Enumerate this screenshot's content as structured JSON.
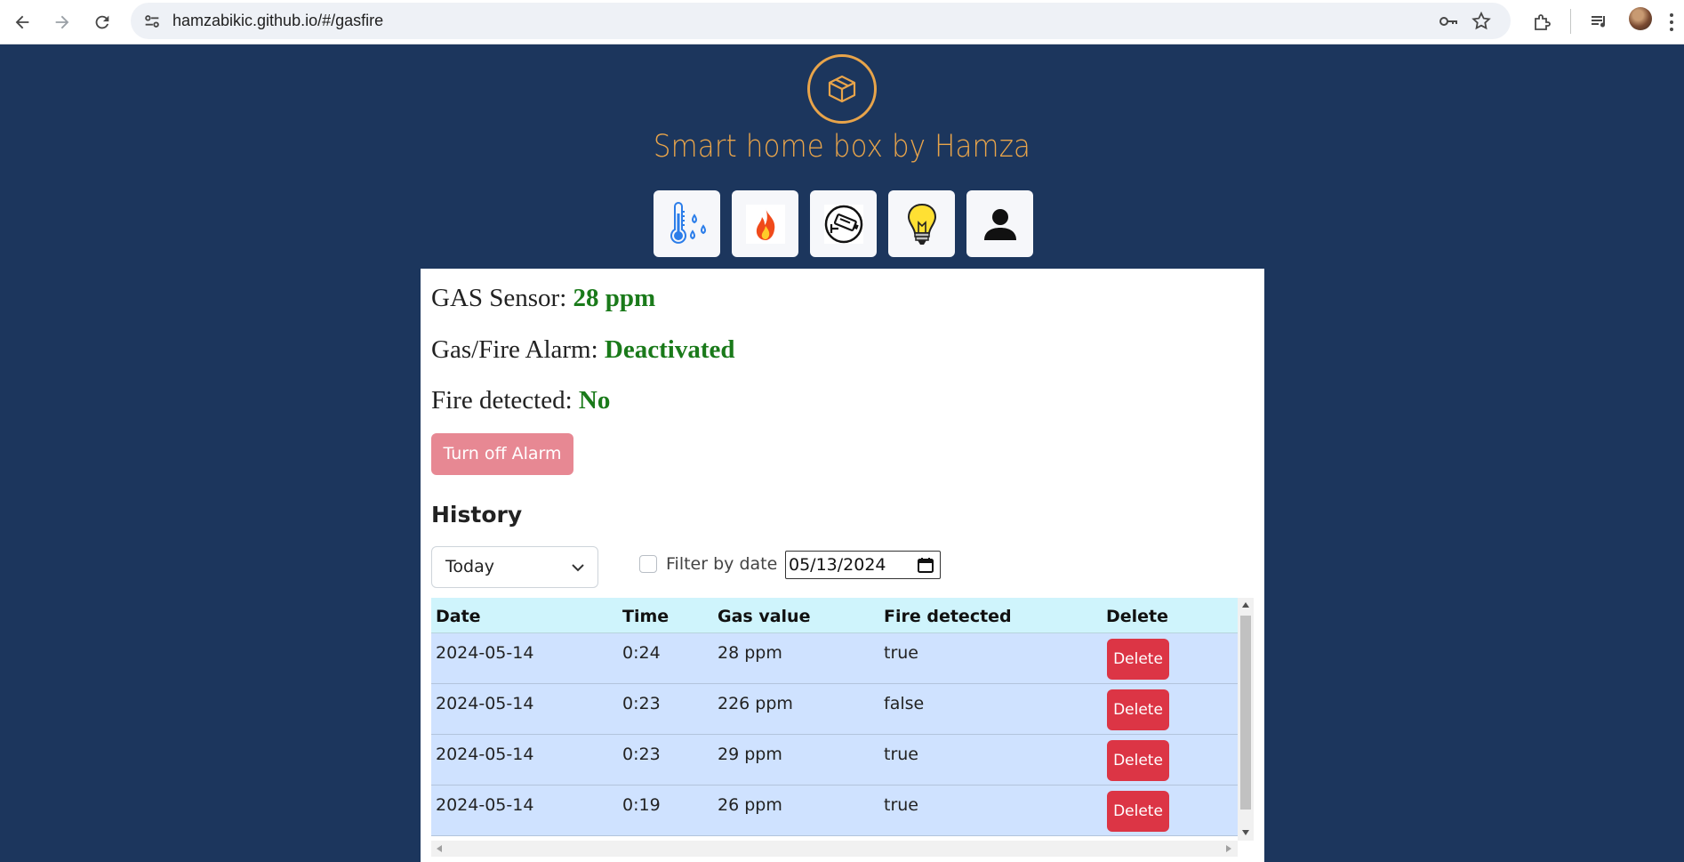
{
  "browser": {
    "url": "hamzabikic.github.io/#/gasfire"
  },
  "app": {
    "title": "Smart home box by Hamza",
    "colors": {
      "background": "#1c365d",
      "accent": "#e8a44a",
      "ok": "#1a7a1a",
      "danger": "#dc3545"
    },
    "nav_tiles": [
      {
        "name": "temperature-humidity",
        "icon": "thermometer-drops-icon"
      },
      {
        "name": "gas-fire",
        "icon": "fire-icon"
      },
      {
        "name": "camera",
        "icon": "security-camera-icon"
      },
      {
        "name": "lights",
        "icon": "lightbulb-icon"
      },
      {
        "name": "user",
        "icon": "user-icon"
      }
    ]
  },
  "status": {
    "gas_label": "GAS Sensor:",
    "gas_value": "28 ppm",
    "alarm_label": "Gas/Fire Alarm:",
    "alarm_value": "Deactivated",
    "fire_label": "Fire detected:",
    "fire_value": "No",
    "turn_off_label": "Turn off Alarm"
  },
  "history": {
    "title": "History",
    "period_selected": "Today",
    "filter_label": "Filter by date",
    "filter_checked": false,
    "date_value": "05/13/2024",
    "columns": [
      "Date",
      "Time",
      "Gas value",
      "Fire detected",
      "Delete"
    ],
    "rows": [
      {
        "date": "2024-05-14",
        "time": "0:24",
        "gas": "28 ppm",
        "fire": "true",
        "action": "Delete"
      },
      {
        "date": "2024-05-14",
        "time": "0:23",
        "gas": "226 ppm",
        "fire": "false",
        "action": "Delete"
      },
      {
        "date": "2024-05-14",
        "time": "0:23",
        "gas": "29 ppm",
        "fire": "true",
        "action": "Delete"
      },
      {
        "date": "2024-05-14",
        "time": "0:19",
        "gas": "26 ppm",
        "fire": "true",
        "action": "Delete"
      }
    ]
  }
}
